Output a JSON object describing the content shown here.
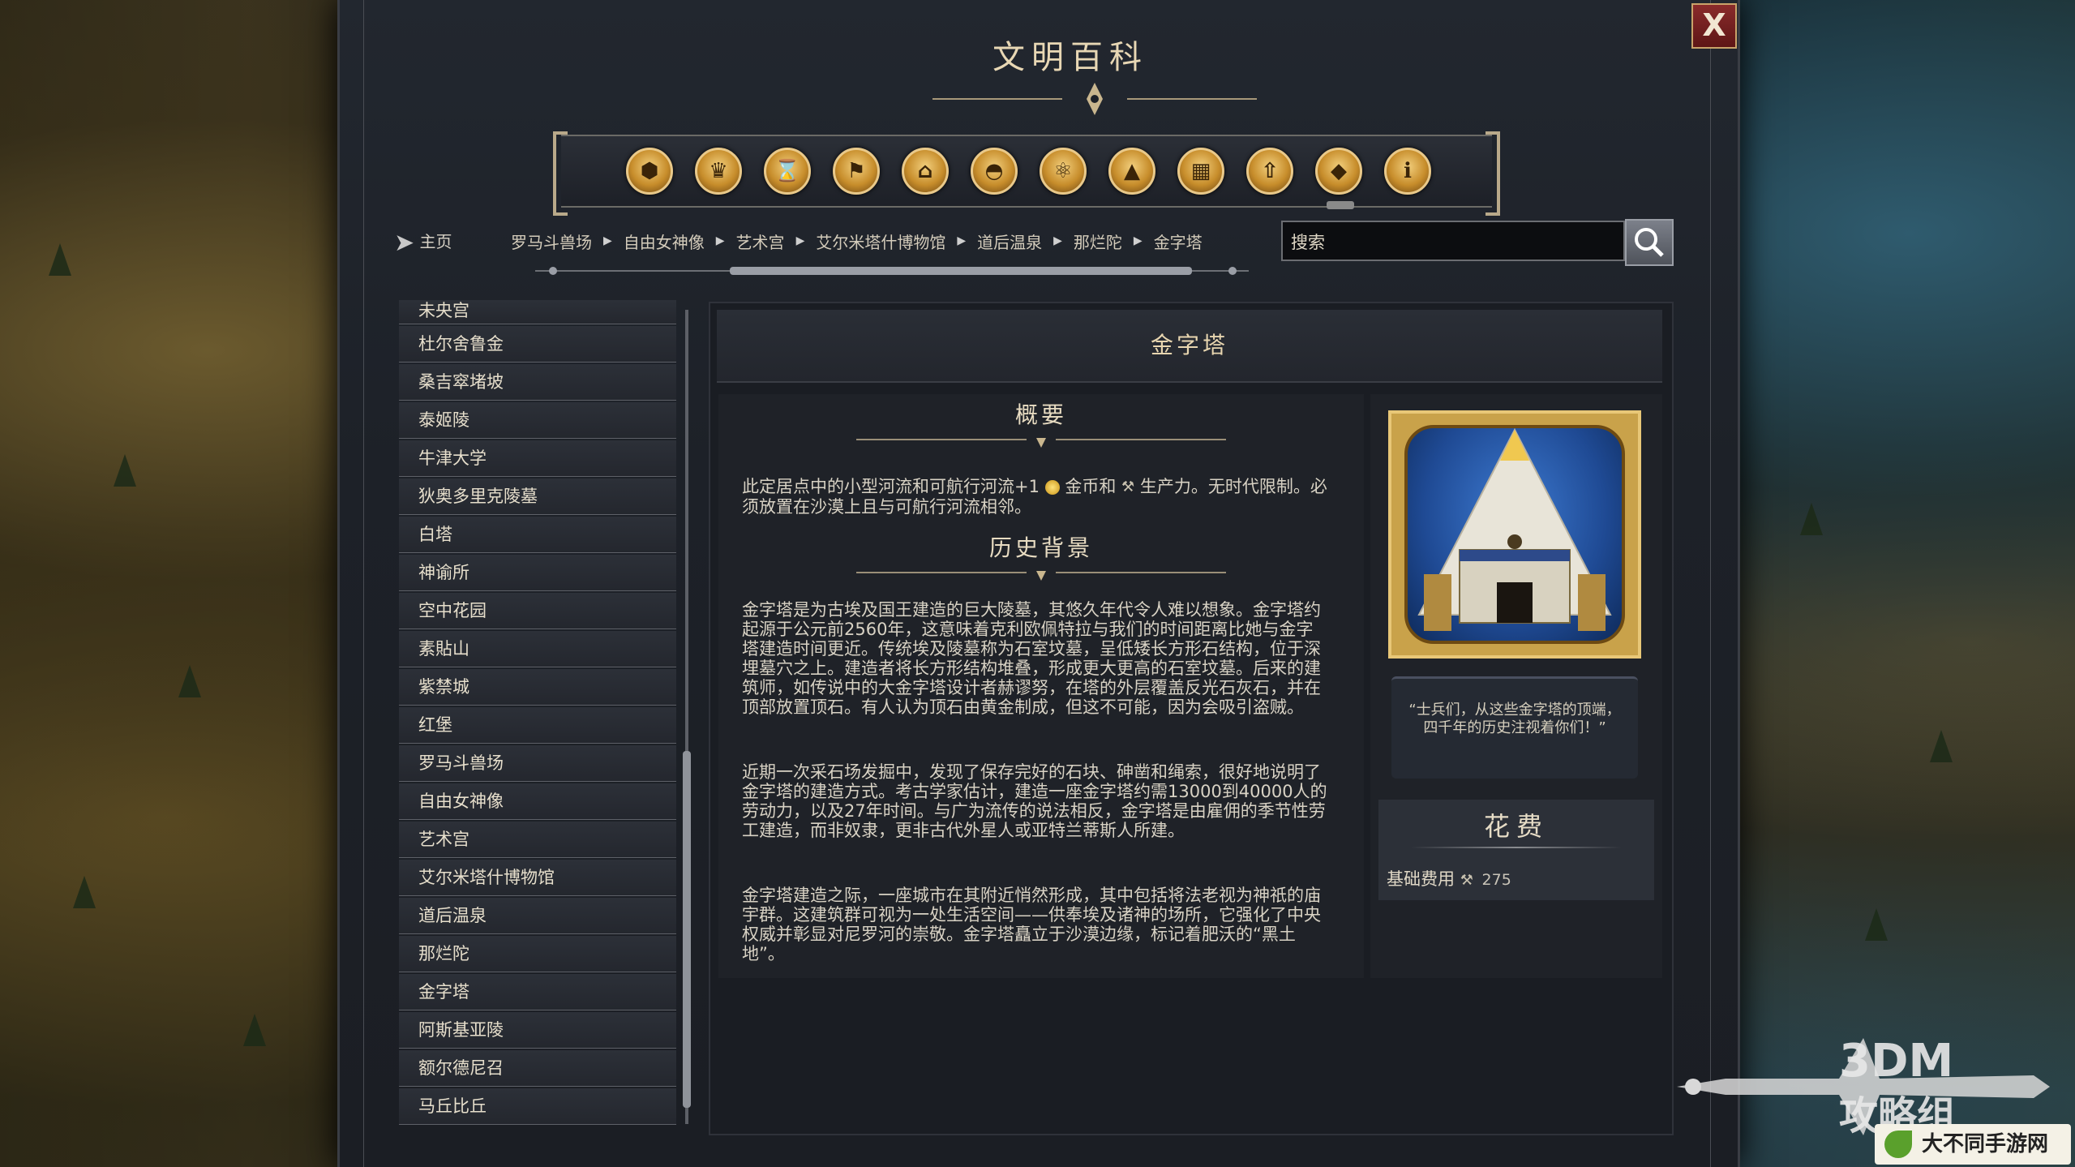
{
  "window": {
    "title": "文明百科",
    "close_label": "X"
  },
  "categories": [
    {
      "icon": "units-icon",
      "glyph": "⬢"
    },
    {
      "icon": "goblet-icon",
      "glyph": "♛"
    },
    {
      "icon": "hourglass-icon",
      "glyph": "⌛"
    },
    {
      "icon": "flag-icon",
      "glyph": "⚑"
    },
    {
      "icon": "temple-icon",
      "glyph": "⌂"
    },
    {
      "icon": "dome-icon",
      "glyph": "◓"
    },
    {
      "icon": "atom-icon",
      "glyph": "⚛"
    },
    {
      "icon": "mountains-icon",
      "glyph": "▲"
    },
    {
      "icon": "buildings-icon",
      "glyph": "▦"
    },
    {
      "icon": "upgrade-arrow-icon",
      "glyph": "⇧"
    },
    {
      "icon": "book-icon",
      "glyph": "◆"
    },
    {
      "icon": "info-icon",
      "glyph": "ℹ"
    }
  ],
  "nav": {
    "home_label": "主页",
    "breadcrumbs": [
      "罗马斗兽场",
      "自由女神像",
      "艺术宫",
      "艾尔米塔什博物馆",
      "道后温泉",
      "那烂陀",
      "金字塔"
    ],
    "search_placeholder": "搜索"
  },
  "list": {
    "items": [
      "未央宫",
      "杜尔舍鲁金",
      "桑吉窣堵坡",
      "泰姬陵",
      "牛津大学",
      "狄奥多里克陵墓",
      "白塔",
      "神谕所",
      "空中花园",
      "素貼山",
      "紫禁城",
      "红堡",
      "罗马斗兽场",
      "自由女神像",
      "艺术宫",
      "艾尔米塔什博物馆",
      "道后温泉",
      "那烂陀",
      "金字塔",
      "阿斯基亚陵",
      "额尔德尼召",
      "马丘比丘"
    ]
  },
  "article": {
    "title": "金字塔",
    "overview_title": "概要",
    "overview_text_before": "此定居点中的小型河流和可航行河流+1",
    "overview_text_mid": "金币和",
    "overview_text_after": "生产力。无时代限制。必须放置在沙漠上且与可航行河流相邻。",
    "history_title": "历史背景",
    "history_paragraphs": [
      "金字塔是为古埃及国王建造的巨大陵墓，其悠久年代令人难以想象。金字塔约起源于公元前2560年，这意味着克利欧佩特拉与我们的时间距离比她与金字塔建造时间更近。传统埃及陵墓称为石室坟墓，呈低矮长方形石结构，位于深埋墓穴之上。建造者将长方形结构堆叠，形成更大更高的石室坟墓。后来的建筑师，如传说中的大金字塔设计者赫谬努，在塔的外层覆盖反光石灰石，并在顶部放置顶石。有人认为顶石由黄金制成，但这不可能，因为会吸引盗贼。",
      "近期一次采石场发掘中，发现了保存完好的石块、砷凿和绳索，很好地说明了金字塔的建造方式。考古学家估计，建造一座金字塔约需13000到40000人的劳动力，以及27年时间。与广为流传的说法相反，金字塔是由雇佣的季节性劳工建造，而非奴隶，更非古代外星人或亚特兰蒂斯人所建。",
      "金字塔建造之际，一座城市在其附近悄然形成，其中包括将法老视为神祇的庙宇群。这建筑群可视为一处生活空间——供奉埃及诸神的场所，它强化了中央权威并彰显对尼罗河的崇敬。金字塔矗立于沙漠边缘，标记着肥沃的“黑土地”。"
    ],
    "quote": "“士兵们，从这些金字塔的顶端，四千年的历史注视着你们！”",
    "cost_title": "花费",
    "cost_label": "基础费用",
    "cost_value": "275"
  },
  "watermark": {
    "line1": "3DM",
    "line2": "攻略组",
    "site": "大不同手游网"
  },
  "colors": {
    "accent_gold": "#e8c777",
    "close_red": "#8a2b2b",
    "text_cream": "#e8d6b0"
  }
}
